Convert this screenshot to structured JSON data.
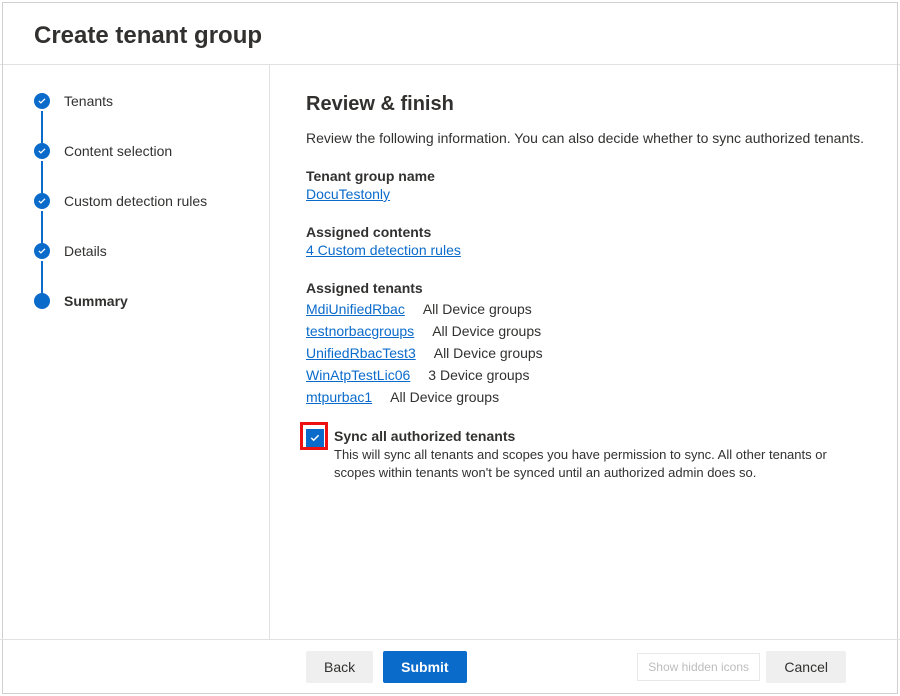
{
  "pageTitle": "Create tenant group",
  "steps": [
    {
      "label": "Tenants",
      "state": "done"
    },
    {
      "label": "Content selection",
      "state": "done"
    },
    {
      "label": "Custom detection rules",
      "state": "done"
    },
    {
      "label": "Details",
      "state": "done"
    },
    {
      "label": "Summary",
      "state": "current"
    }
  ],
  "review": {
    "heading": "Review & finish",
    "description": "Review the following information. You can also decide whether to sync authorized tenants.",
    "groupNameLabel": "Tenant group name",
    "groupNameValue": "DocuTestonly",
    "assignedContentsLabel": "Assigned contents",
    "assignedContentsValue": "4 Custom detection rules",
    "assignedTenantsLabel": "Assigned tenants",
    "tenants": [
      {
        "name": "MdiUnifiedRbac",
        "scope": "All Device groups"
      },
      {
        "name": "testnorbacgroups",
        "scope": "All Device groups"
      },
      {
        "name": "UnifiedRbacTest3",
        "scope": "All Device groups"
      },
      {
        "name": "WinAtpTestLic06",
        "scope": "3 Device groups"
      },
      {
        "name": "mtpurbac1",
        "scope": "All Device groups"
      }
    ],
    "sync": {
      "checked": true,
      "title": "Sync all authorized tenants",
      "sub": "This will sync all tenants and scopes you have permission to sync. All other tenants or scopes within tenants won't be synced until an authorized admin does so."
    }
  },
  "footer": {
    "back": "Back",
    "submit": "Submit",
    "cancel": "Cancel",
    "hiddenIcons": "Show hidden icons"
  }
}
